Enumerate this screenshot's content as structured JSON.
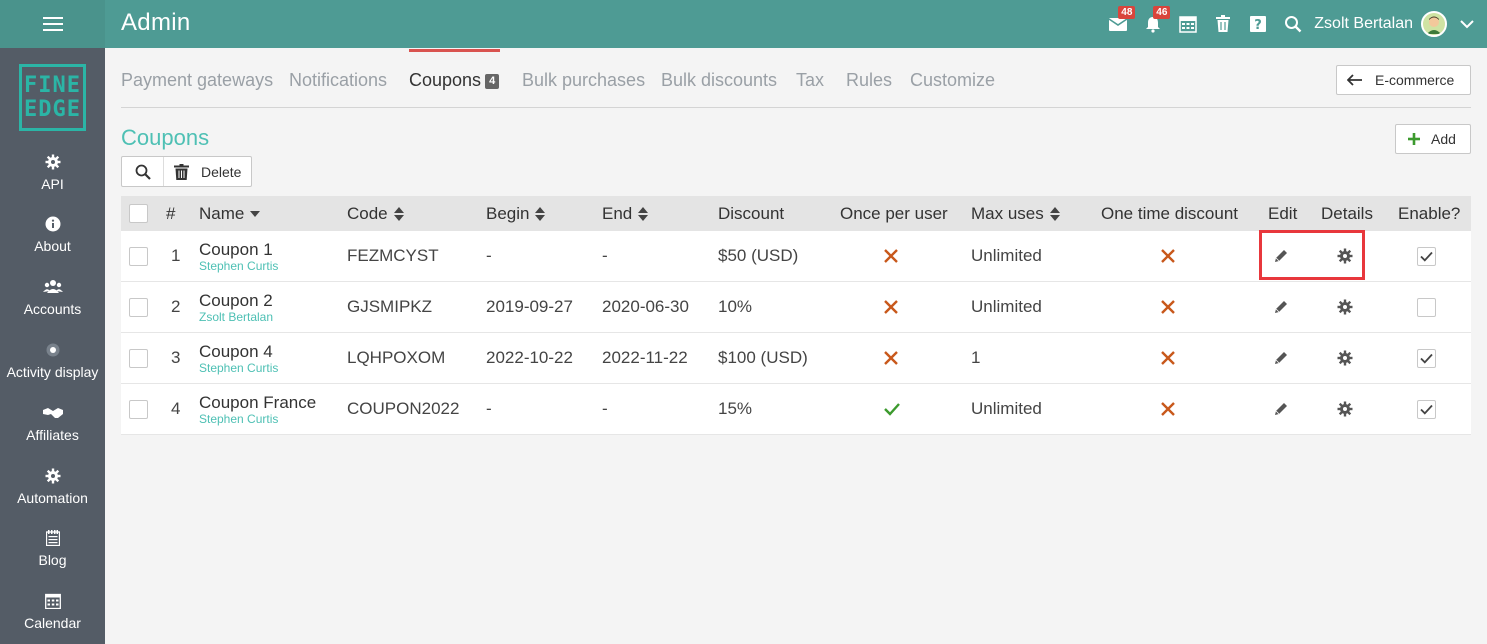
{
  "header": {
    "menu_icon": "hamburger-icon",
    "title": "Admin",
    "mail_badge": "48",
    "notifications_badge": "46",
    "user_name": "Zsolt Bertalan",
    "icons": [
      "mail-icon",
      "bell-icon",
      "calendar-icon",
      "trash-icon",
      "help-icon",
      "search-icon",
      "avatar",
      "chevron-down-icon"
    ]
  },
  "sidebar": {
    "logo_line1": "FINE",
    "logo_line2": "EDGE",
    "items": [
      {
        "label": "API",
        "icon": "gear-icon"
      },
      {
        "label": "About",
        "icon": "info-icon"
      },
      {
        "label": "Accounts",
        "icon": "users-icon"
      },
      {
        "label": "Activity display",
        "icon": "radio-dot-icon"
      },
      {
        "label": "Affiliates",
        "icon": "handshake-icon"
      },
      {
        "label": "Automation",
        "icon": "gear-icon"
      },
      {
        "label": "Blog",
        "icon": "notepad-icon"
      },
      {
        "label": "Calendar",
        "icon": "calendar-grid-icon"
      }
    ]
  },
  "tabs": {
    "items": [
      {
        "label": "Payment gateways"
      },
      {
        "label": "Notifications"
      },
      {
        "label": "Coupons",
        "count": "4",
        "active": true
      },
      {
        "label": "Bulk purchases"
      },
      {
        "label": "Bulk discounts"
      },
      {
        "label": "Tax"
      },
      {
        "label": "Rules"
      },
      {
        "label": "Customize"
      }
    ],
    "back_button": "E-commerce"
  },
  "section": {
    "title": "Coupons",
    "add_label": "Add",
    "delete_label": "Delete"
  },
  "table": {
    "headers": {
      "num": "#",
      "name": "Name",
      "code": "Code",
      "begin": "Begin",
      "end": "End",
      "discount": "Discount",
      "once_per_user": "Once per user",
      "max_uses": "Max uses",
      "one_time_discount": "One time discount",
      "edit": "Edit",
      "details": "Details",
      "enable": "Enable?"
    },
    "rows": [
      {
        "num": "1",
        "name": "Coupon 1",
        "owner": "Stephen Curtis",
        "code": "FEZMCYST",
        "begin": "-",
        "end": "-",
        "discount": "$50 (USD)",
        "once_per_user": false,
        "max_uses": "Unlimited",
        "one_time_discount": false,
        "enabled": true
      },
      {
        "num": "2",
        "name": "Coupon 2",
        "owner": "Zsolt Bertalan",
        "code": "GJSMIPKZ",
        "begin": "2019-09-27",
        "end": "2020-06-30",
        "discount": "10%",
        "once_per_user": false,
        "max_uses": "Unlimited",
        "one_time_discount": false,
        "enabled": false
      },
      {
        "num": "3",
        "name": "Coupon 4",
        "owner": "Stephen Curtis",
        "code": "LQHPOXOM",
        "begin": "2022-10-22",
        "end": "2022-11-22",
        "discount": "$100 (USD)",
        "once_per_user": false,
        "max_uses": "1",
        "one_time_discount": false,
        "enabled": true
      },
      {
        "num": "4",
        "name": "Coupon France",
        "owner": "Stephen Curtis",
        "code": "COUPON2022",
        "begin": "-",
        "end": "-",
        "discount": "15%",
        "once_per_user": true,
        "max_uses": "Unlimited",
        "one_time_discount": false,
        "enabled": true
      }
    ]
  },
  "colors": {
    "header_bg": "#4e9b94",
    "sidebar_bg": "#545c66",
    "accent_teal": "#4ec0b4",
    "cross_orange": "#c8581b",
    "check_green": "#3c9a2e",
    "highlight_red": "#e8373c"
  }
}
